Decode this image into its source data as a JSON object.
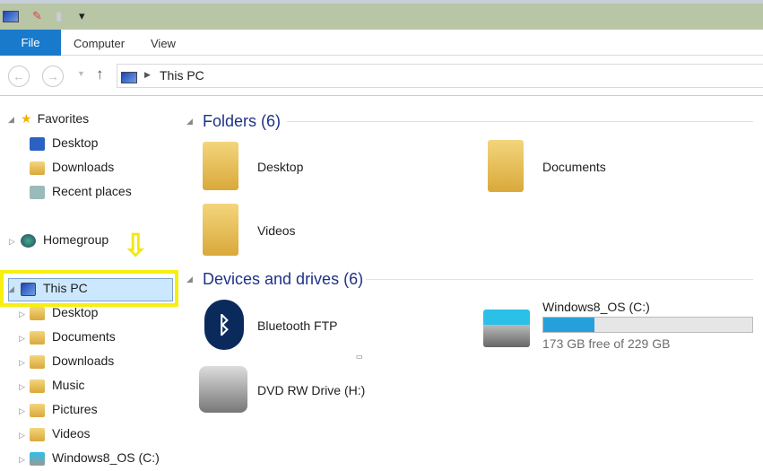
{
  "ribbon": {
    "file": "File",
    "tabs": [
      "Computer",
      "View"
    ]
  },
  "address": {
    "path": "This PC"
  },
  "sidebar": {
    "favorites": "Favorites",
    "fav_items": [
      "Desktop",
      "Downloads",
      "Recent places"
    ],
    "homegroup": "Homegroup",
    "this_pc": "This PC",
    "pc_items": [
      "Desktop",
      "Documents",
      "Downloads",
      "Music",
      "Pictures",
      "Videos",
      "Windows8_OS (C:)"
    ]
  },
  "main": {
    "folders_header": "Folders (6)",
    "folders": [
      "Desktop",
      "Documents",
      "Videos"
    ],
    "devices_header": "Devices and drives (6)",
    "devices": [
      {
        "name": "Bluetooth FTP"
      },
      {
        "name": "DVD RW Drive (H:)"
      }
    ],
    "drive": {
      "name": "Windows8_OS (C:)",
      "free_text": "173 GB free of 229 GB",
      "used_fraction": 0.245
    }
  },
  "colors": {
    "accent": "#1979ca",
    "highlight": "#f6ef10",
    "bar": "#26a0da"
  }
}
